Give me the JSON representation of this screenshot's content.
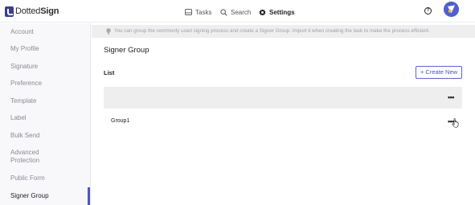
{
  "app": {
    "logo_prefix": "Dotted",
    "logo_suffix": "Sign"
  },
  "topnav": {
    "tasks": "Tasks",
    "search": "Search",
    "settings": "Settings"
  },
  "sidebar": {
    "items": [
      {
        "label": "Account"
      },
      {
        "label": "My Profile"
      },
      {
        "label": "Signature"
      },
      {
        "label": "Preference"
      },
      {
        "label": "Template"
      },
      {
        "label": "Label"
      },
      {
        "label": "Bulk Send"
      },
      {
        "label": "Advanced",
        "label2": "Protection"
      },
      {
        "label": "Public Form"
      },
      {
        "label": "Signer Group",
        "active": true
      }
    ]
  },
  "info": {
    "text": "You can group the commonly used signing process and create a Signer Group. Import it when creating the task to make the process efficient."
  },
  "main": {
    "title": "Signer Group",
    "list_label": "List",
    "create_button": "+ Create New",
    "header_menu": "•••",
    "rows": [
      {
        "name": "Group1",
        "menu": "•••"
      }
    ]
  },
  "colors": {
    "accent": "#4b58c8",
    "sidebar_bg": "#f8f8fa",
    "info_bg": "#eeeeef"
  }
}
